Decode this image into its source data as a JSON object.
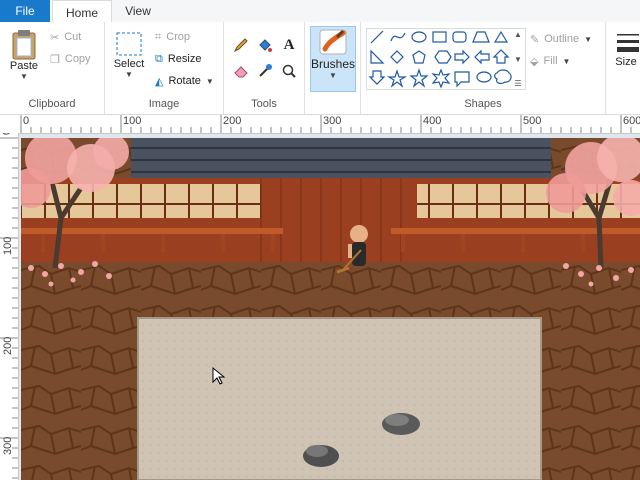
{
  "tabs": {
    "file": "File",
    "home": "Home",
    "view": "View"
  },
  "clipboard": {
    "paste": "Paste",
    "cut": "Cut",
    "copy": "Copy",
    "label": "Clipboard"
  },
  "image": {
    "select": "Select",
    "crop": "Crop",
    "resize": "Resize",
    "rotate": "Rotate",
    "label": "Image"
  },
  "tools": {
    "label": "Tools"
  },
  "brushes": {
    "label": "Brushes"
  },
  "shapes": {
    "label": "Shapes",
    "outline": "Outline",
    "fill": "Fill"
  },
  "size": {
    "label": "Size"
  },
  "ruler": {
    "h": [
      "0",
      "100",
      "200",
      "300",
      "400",
      "500",
      "600"
    ],
    "v": [
      "0",
      "100",
      "200",
      "300"
    ]
  },
  "colors": {
    "accent": "#1979ca",
    "wood": "#8a3b1e",
    "sand": "#cfc3b3",
    "ground": "#7a4a2c",
    "blossom": "#f4a6a6"
  }
}
